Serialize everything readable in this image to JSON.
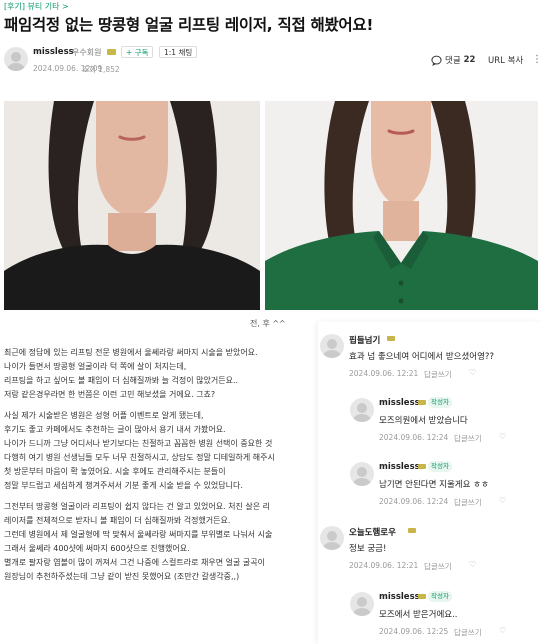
{
  "post": {
    "breadcrumb": "[후기] 뷰티 기타 >",
    "title": "패임걱정 없는 땅콩형 얼굴 리프팅 레이저, 직접 해봤어요!",
    "author": {
      "name": "missless",
      "grade": "우수회원",
      "subscribe_label": "+ 구독",
      "chat_label": "1:1 채팅",
      "date": "2024.09.06. 12:09",
      "views": "조회 1,852"
    },
    "actions": {
      "comments_label": "댓글",
      "comments_count": "22",
      "url_copy": "URL 복사"
    },
    "photo_caption": "전, 후 ^^",
    "body": [
      "최근에 정답에 있는 리프팅 전문 병원에서 울쎄라랑 써마지 시술을 받았어요.",
      "나이가 들면서 땅콩형 얼굴이라 턱 쪽에 살이 처지는데,",
      "리프팅을 하고 싶어도 볼 패임이 더 심해질까봐 늘 걱정이 많았거든요..",
      "저랑 같은경우라면 한 번쯤은 이런 고민 해보셨을 거에요. 그쵸?",
      "",
      "사실 제가 시술받은 병원은 성형 어플 이벤트로 알게 됐는데,",
      "후기도 좋고 카페에서도 추천하는 글이 많아서 용기 내서 가봤어요.",
      "나이가 드니까 그냥 어디서나 받기보다는 친절하고 꼼꼼한 병원 선택이 중요한 것",
      "다행히 여기 병원 선생님들 모두 너무 친절하시고, 상담도 정말 디테일하게 해주시",
      "첫 방문부터 마음이 확 놓였어요. 시술 후에도 관리해주시는 분들이",
      "정말 부드럽고 세심하게 챙겨주셔서 기분 좋게 시술 받을 수 있었답니다.",
      "",
      "그전부터 땅콩형 얼굴이라 리프팅이 쉽지 않다는 건 알고 있었어요. 처진 살은 리",
      "레이저를 전체적으로 받자니 볼 패임이 더 심해질까봐 걱정했거든요.",
      "그런데 병원에서 제 얼굴형에 딱 맞춰서 울쎄라랑 써마지를 부위별로 나눠서 시술",
      "그래서 울쎄라 400샷에 써마지 600샷으로 진행했어요.",
      "별개로 팔자랑 염볼이 많이 꺼져서 그건 나중에 스컬트라로 채우면 얼굴 굴곡이",
      "원장님이 추천하주셨는데 그냥 같이 받진 못했어요 (조만간 갈생각중,,)"
    ]
  },
  "comments": [
    {
      "name": "핍들넘기",
      "text": "효과 넘 좋으네여 어디에서 받으셨어영??",
      "date": "2024.09.06. 12:21",
      "reply": "답글쓰기",
      "writer_badge": ""
    },
    {
      "name": "missless",
      "text": "모즈의원에서 받았습니다",
      "date": "2024.09.06. 12:24",
      "reply": "답글쓰기",
      "writer_badge": "작성자"
    },
    {
      "name": "missless",
      "text": "남기면 안된다면 지울게요 ㅎㅎ",
      "date": "2024.09.06. 12:24",
      "reply": "답글쓰기",
      "writer_badge": "작성자"
    },
    {
      "name": "오늘도햄로우",
      "text": "정보 궁금!",
      "date": "2024.09.06. 12:21",
      "reply": "답글쓰기",
      "writer_badge": ""
    },
    {
      "name": "missless",
      "text": "모즈에서 받은거에요..",
      "date": "2024.09.06. 12:25",
      "reply": "답글쓰기",
      "writer_badge": "작성자"
    }
  ],
  "colors": {
    "accent": "#0a9a6a",
    "grade_badge": "#c9b64b",
    "left_shirt": "#1a1a1a",
    "right_shirt": "#1f6e42"
  },
  "icons": [
    "avatar",
    "grade-badge-icon",
    "comment-icon",
    "more-icon",
    "heart-icon"
  ]
}
